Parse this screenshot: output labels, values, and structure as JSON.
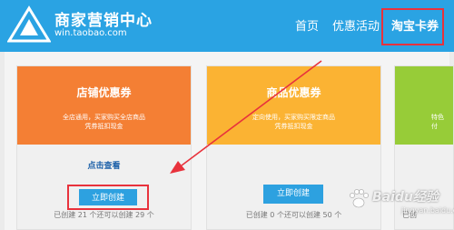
{
  "header": {
    "brand_title": "商家营销中心",
    "brand_url": "win.taobao.com",
    "nav": {
      "home": "首页",
      "promo": "优惠活动",
      "card": "淘宝卡券"
    }
  },
  "cards": {
    "store": {
      "title": "店铺优惠券",
      "desc_line1": "全店通用，买家购买全店商品",
      "desc_line2": "凭券抵扣现金",
      "link": "点击查看",
      "button": "立即创建",
      "count": "已创建 21 个还可以创建 29 个"
    },
    "goods": {
      "title": "商品优惠券",
      "desc_line1": "定向使用，买家购买限定商品",
      "desc_line2": "凭券抵扣现金",
      "button": "立即创建",
      "count": "已创建 0 个还可以创建 50 个"
    },
    "third": {
      "desc_line1": "特色",
      "desc_line2": "付",
      "count": "已创"
    }
  },
  "watermark": {
    "text": "Baidu经验",
    "sub": "jingyan.baidu.com"
  },
  "colors": {
    "header_blue": "#2aa3e3",
    "store_orange": "#f47f34",
    "goods_yellow": "#fbb333",
    "third_green": "#97cc38",
    "button_blue": "#2da1e0",
    "highlight_red": "#e8323c"
  }
}
